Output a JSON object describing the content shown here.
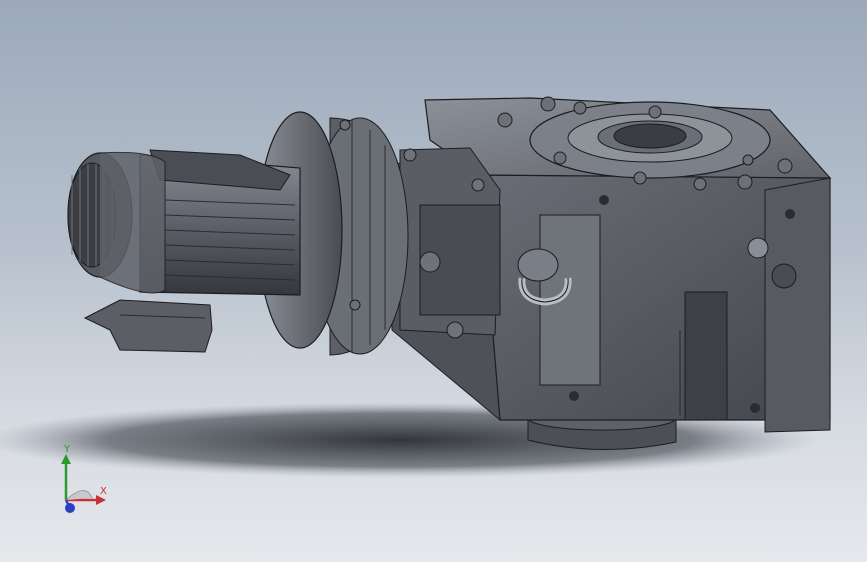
{
  "viewport": {
    "background_top": "#9ca9ba",
    "background_bottom": "#e6e8ec"
  },
  "model": {
    "body_color": "#5c5f66",
    "body_light": "#7e828a",
    "body_dark": "#3a3c41",
    "edge_color": "#1c1d20"
  },
  "triad": {
    "y_label": "Y",
    "x_label": "X",
    "y_color": "#2e9a2e",
    "x_color": "#c83232",
    "z_color": "#2b3fc4"
  }
}
